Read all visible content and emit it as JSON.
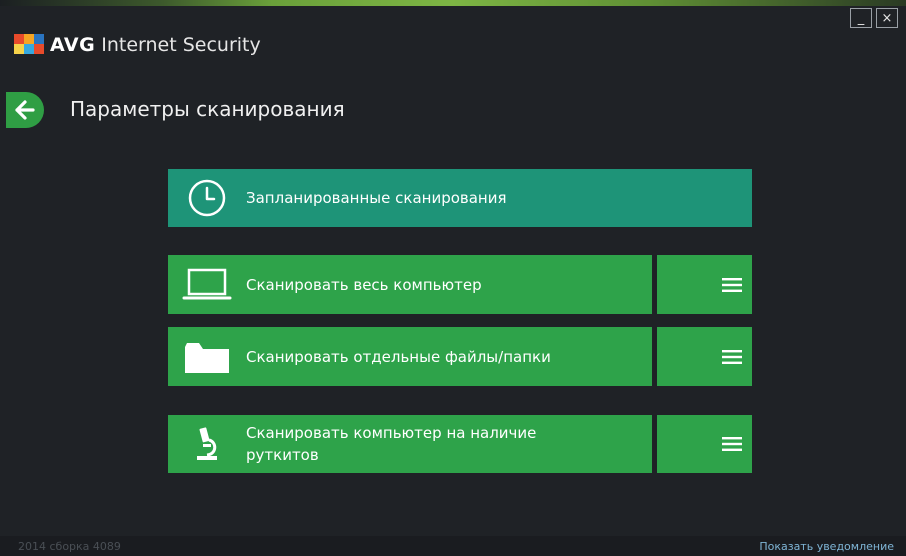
{
  "window": {
    "minimize_label": "_",
    "close_label": "×"
  },
  "brand": {
    "name_main": "AVG",
    "name_rest": "Internet Security"
  },
  "header": {
    "title": "Параметры сканирования"
  },
  "actions": {
    "scheduled": {
      "label": "Запланированные сканирования",
      "icon": "clock-icon"
    },
    "full": {
      "label": "Сканировать весь компьютер",
      "icon": "laptop-icon"
    },
    "files": {
      "label": "Сканировать отдельные файлы/папки",
      "icon": "folder-icon"
    },
    "rootkit": {
      "label_line1": "Сканировать компьютер на наличие",
      "label_line2": "руткитов",
      "icon": "microscope-icon"
    }
  },
  "footer": {
    "build": "2014  сборка 4089",
    "notify": "Показать уведомление"
  },
  "colors": {
    "background": "#1f2226",
    "scheduled_tile": "#1e9478",
    "scan_tile": "#2ea34a",
    "back_button": "#2f9e44"
  }
}
